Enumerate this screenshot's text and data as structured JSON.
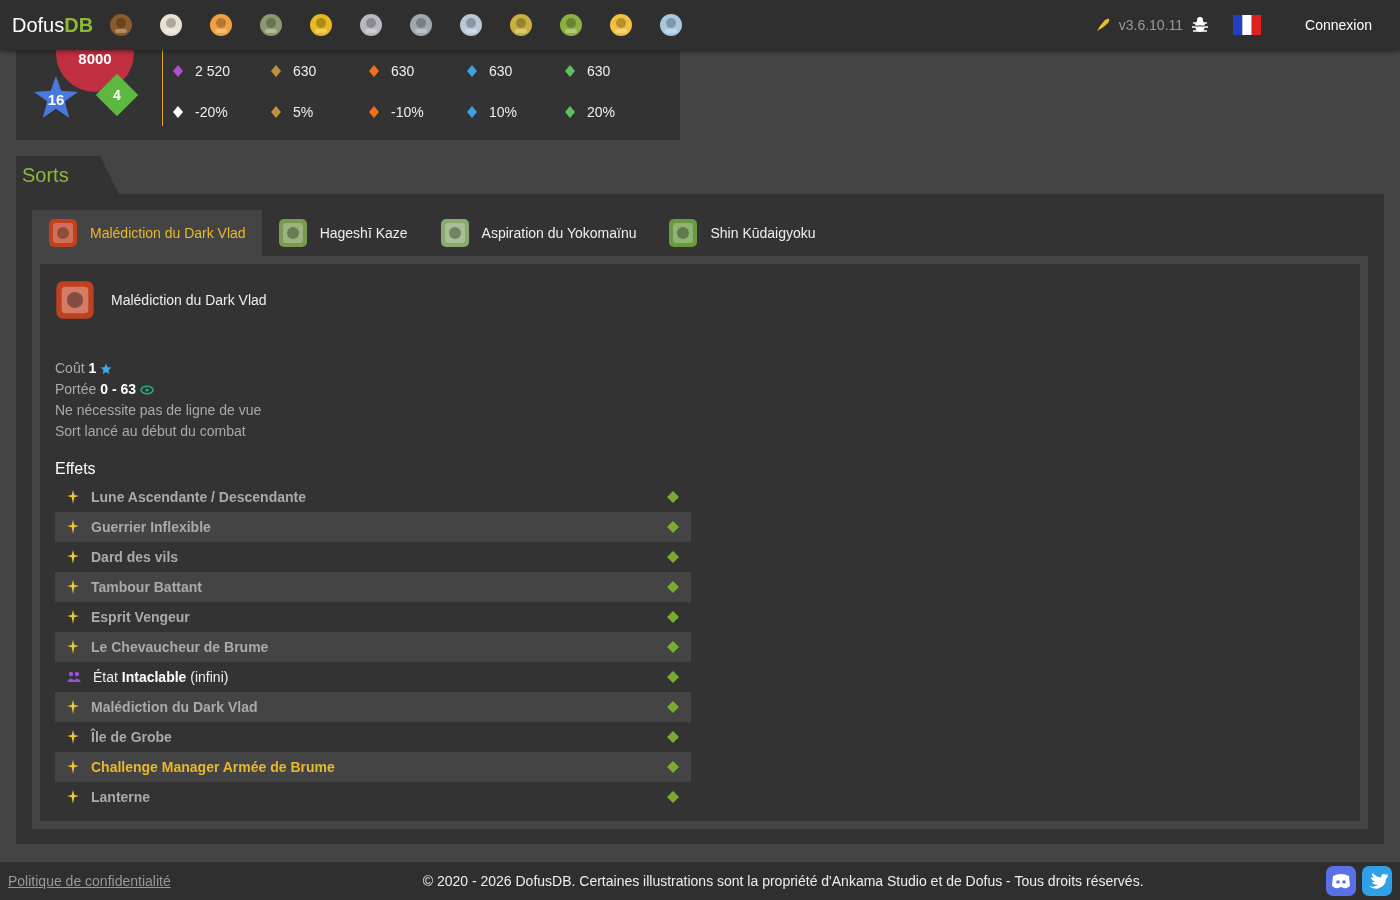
{
  "header": {
    "logo_main": "Dofus",
    "logo_accent": "DB",
    "version": "v3.6.10.11",
    "login": "Connexion"
  },
  "monster": {
    "life": "8000",
    "ap": "16",
    "mp": "4",
    "stats": [
      {
        "kind": "ap",
        "value": "2 520"
      },
      {
        "kind": "earth",
        "value": "630"
      },
      {
        "kind": "fire",
        "value": "630"
      },
      {
        "kind": "water",
        "value": "630"
      },
      {
        "kind": "air",
        "value": "630"
      },
      {
        "kind": "neutral",
        "value": "-20%"
      },
      {
        "kind": "earth",
        "value": "5%"
      },
      {
        "kind": "fire",
        "value": "-10%"
      },
      {
        "kind": "water",
        "value": "10%"
      },
      {
        "kind": "air",
        "value": "20%"
      }
    ]
  },
  "section": {
    "title": "Sorts"
  },
  "tabs": [
    {
      "label": "Malédiction du Dark Vlad",
      "kind": "curse",
      "selected": true
    },
    {
      "label": "Hageshī Kaze",
      "kind": "wind",
      "selected": false
    },
    {
      "label": "Aspiration du Yokomaïnu",
      "kind": "swirl",
      "selected": false
    },
    {
      "label": "Shin Kūdaigyoku",
      "kind": "ring",
      "selected": false
    }
  ],
  "spell": {
    "name": "Malédiction du Dark Vlad",
    "cost_label": "Coût",
    "cost": "1",
    "range_label": "Portée",
    "range": "0 - 63",
    "lines": [
      "Ne nécessite pas de ligne de vue",
      "Sort lancé au début du combat"
    ],
    "effects_title": "Effets",
    "effects": [
      {
        "kind": "spell",
        "text": "Lune Ascendante / Descendante",
        "highlighted": false
      },
      {
        "kind": "spell",
        "text": "Guerrier Inflexible",
        "highlighted": false
      },
      {
        "kind": "spell",
        "text": "Dard des vils",
        "highlighted": false
      },
      {
        "kind": "spell",
        "text": "Tambour Battant",
        "highlighted": false
      },
      {
        "kind": "spell",
        "text": "Esprit Vengeur",
        "highlighted": false
      },
      {
        "kind": "spell",
        "text": "Le Chevaucheur de Brume",
        "highlighted": false
      },
      {
        "kind": "state",
        "text": "État **Intaclable**  (infini)",
        "highlighted": false
      },
      {
        "kind": "spell",
        "text": "Malédiction du Dark Vlad",
        "highlighted": false
      },
      {
        "kind": "spell",
        "text": "Île de Grobe",
        "highlighted": false
      },
      {
        "kind": "spell",
        "text": "Challenge Manager Armée de Brume",
        "highlighted": true
      },
      {
        "kind": "spell",
        "text": "Lanterne",
        "highlighted": false
      }
    ]
  },
  "footer": {
    "privacy": "Politique de confidentialité",
    "copyright": "© 2020 - 2026 DofusDB. Certaines illustrations sont la propriété d'Ankama Studio et de Dofus - Tous droits réservés."
  }
}
